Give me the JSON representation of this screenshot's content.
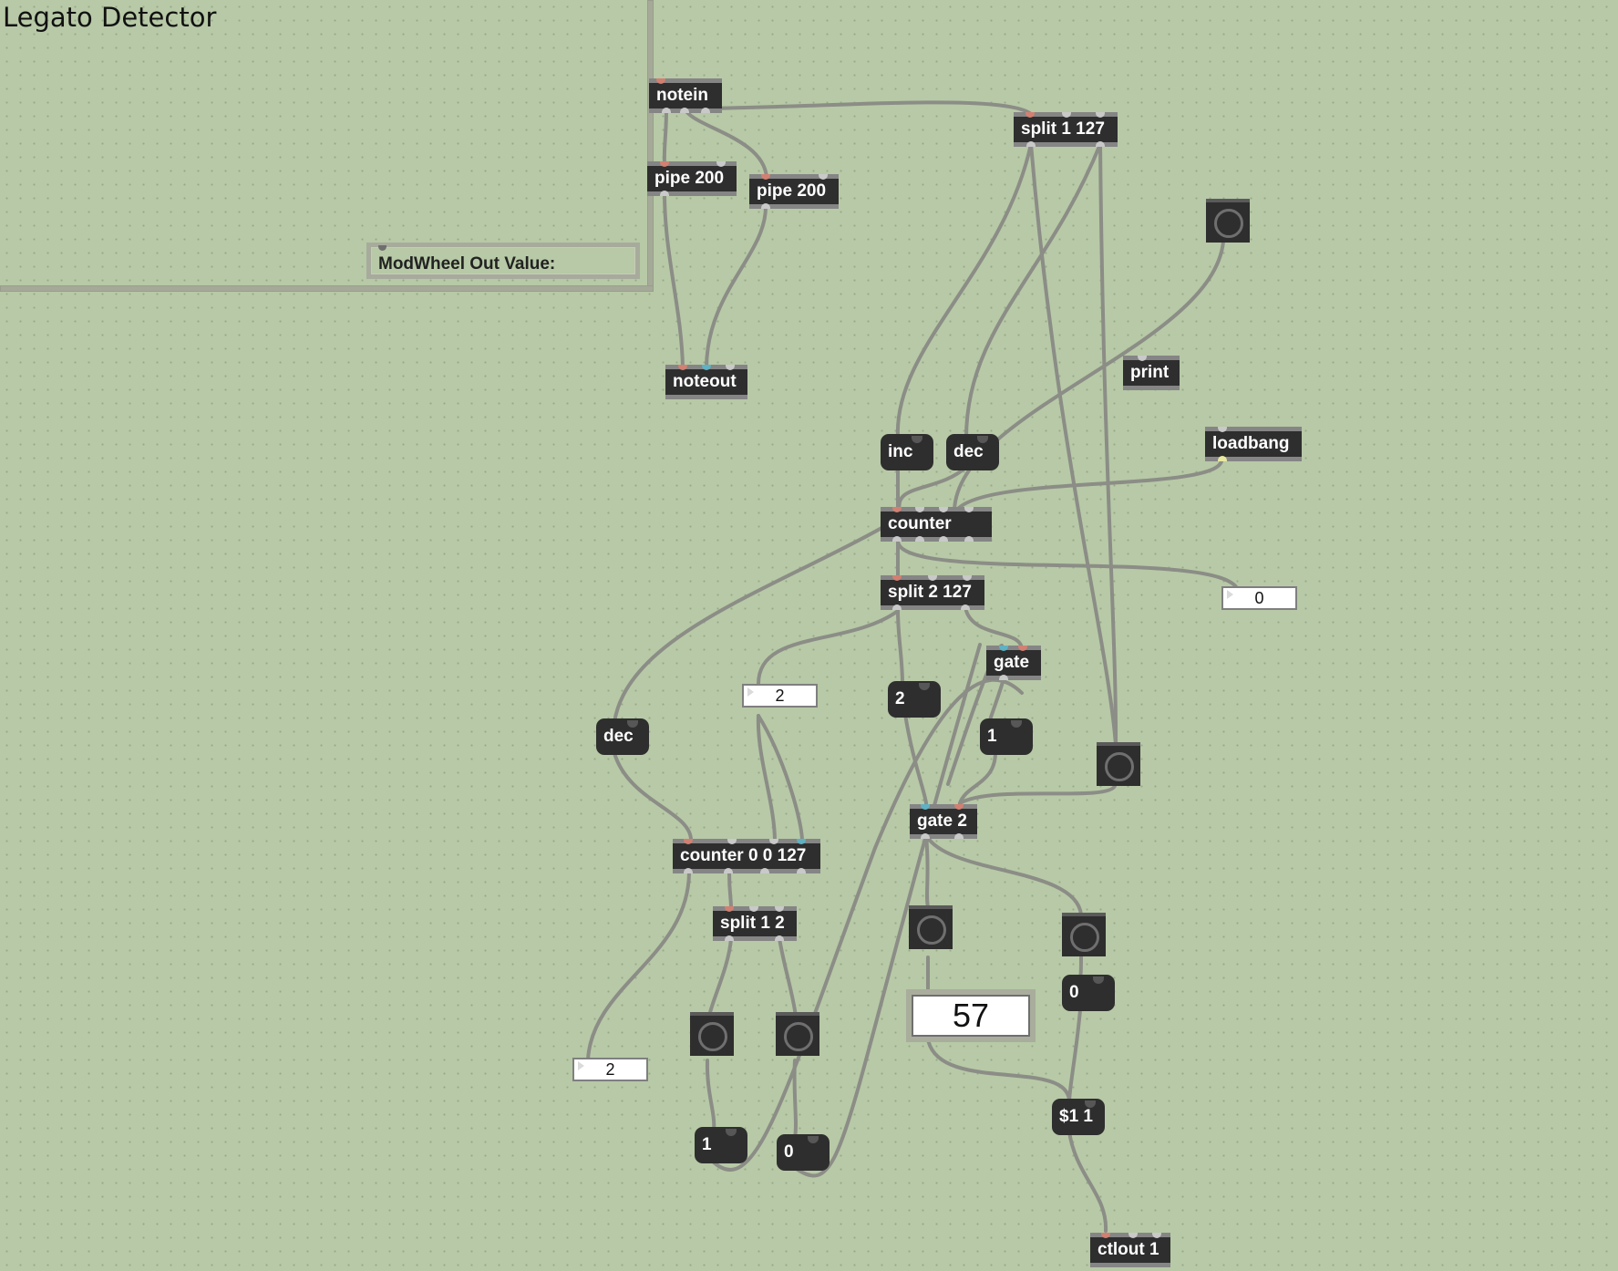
{
  "patcher": {
    "title": "Legato Detector",
    "comment": "ModWheel Out Value:"
  },
  "objects": {
    "notein": "notein",
    "split_1_127": "split 1 127",
    "pipe_200_a": "pipe 200",
    "pipe_200_b": "pipe 200",
    "noteout": "noteout",
    "print": "print",
    "loadbang": "loadbang",
    "counter_main": "counter",
    "split_2_127": "split 2 127",
    "gate": "gate",
    "gate_2": "gate 2",
    "counter_0_0_127": "counter 0 0 127",
    "split_1_2": "split 1 2",
    "ctlout_1": "ctlout 1"
  },
  "messages": {
    "inc": "inc",
    "dec_top": "dec",
    "dec_left": "dec",
    "msg_2": "2",
    "msg_1_right": "1",
    "msg_1_bottom": "1",
    "msg_0_bottom": "0",
    "msg_0_right": "0",
    "set_val": "$1 1"
  },
  "numbers": {
    "right_value": "0",
    "mid_value": "2",
    "left_value": "2",
    "modwheel_value": "57"
  }
}
